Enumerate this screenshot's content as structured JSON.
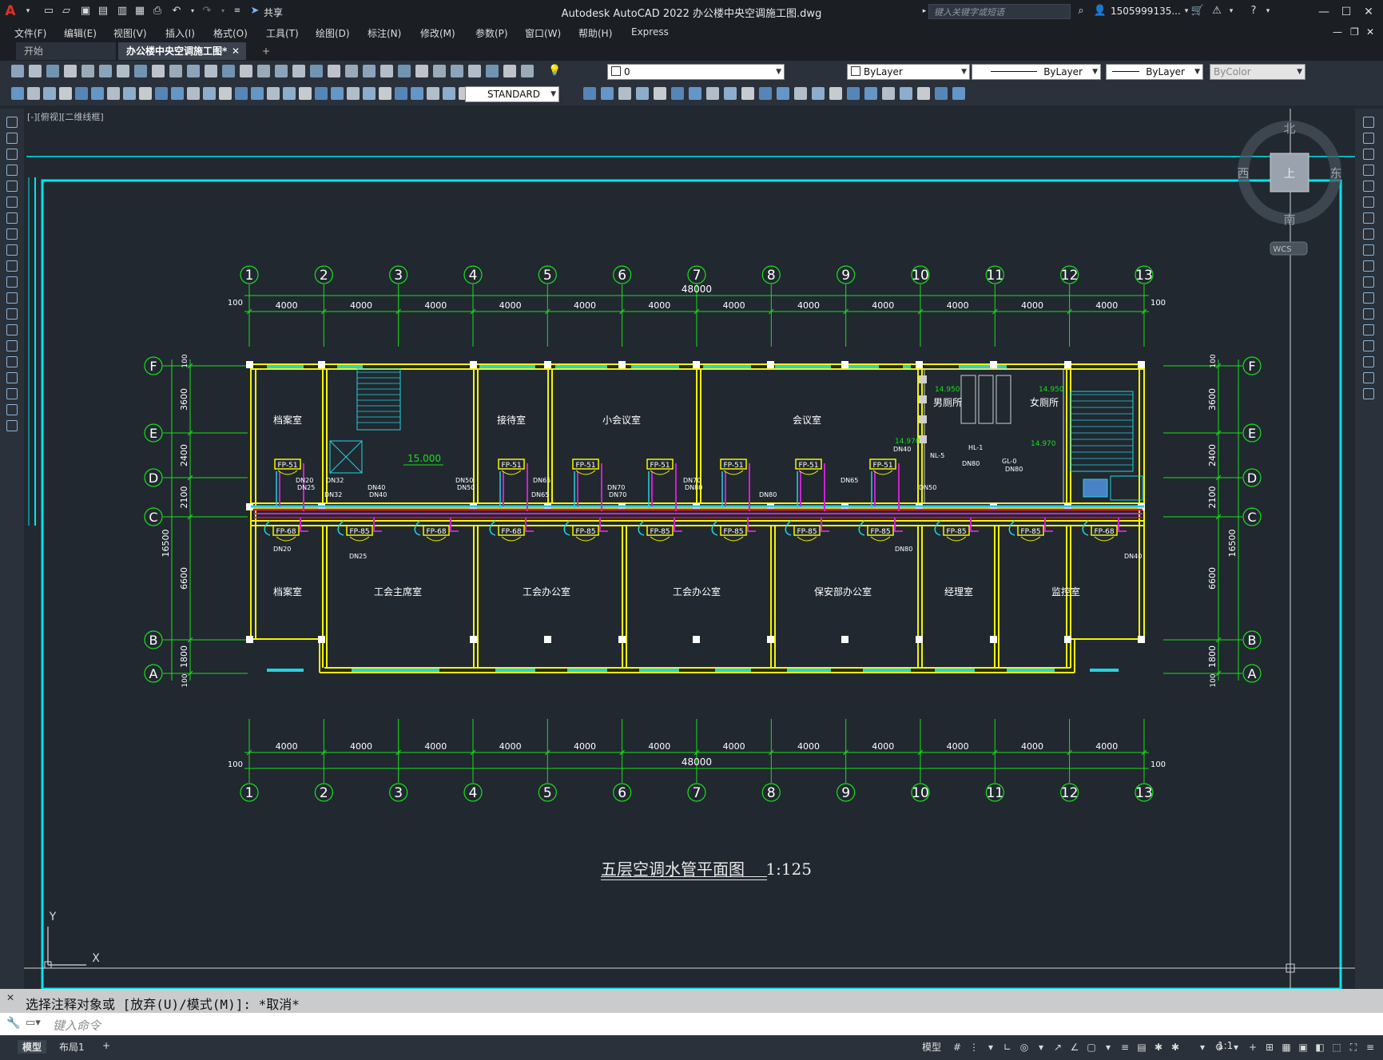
{
  "app": {
    "title": "Autodesk AutoCAD 2022     办公楼中央空调施工图.dwg",
    "share_label": "共享",
    "search_placeholder": "键入关键字或短语",
    "user": "1505999135...",
    "window_controls": [
      "minimize-icon",
      "maximize-icon",
      "close-icon"
    ]
  },
  "menu": [
    "文件(F)",
    "编辑(E)",
    "视图(V)",
    "插入(I)",
    "格式(O)",
    "工具(T)",
    "绘图(D)",
    "标注(N)",
    "修改(M)",
    "参数(P)",
    "窗口(W)",
    "帮助(H)",
    "Express"
  ],
  "tabs": {
    "start": "开始",
    "active": "办公楼中央空调施工图*",
    "close": "✕",
    "add": "+"
  },
  "properties": {
    "layer": "0",
    "color": "ByLayer",
    "linetype": "ByLayer",
    "lineweight": "ByLayer",
    "plotstyle": "ByColor",
    "textstyle": "STANDARD"
  },
  "viewport": {
    "label": "[-][俯视][二维线框]",
    "viewcube": {
      "north": "北",
      "south": "南",
      "west": "西",
      "east": "东",
      "top": "上",
      "wcs": "WCS"
    },
    "ucs": {
      "x": "X",
      "y": "Y"
    }
  },
  "drawing": {
    "title": "五层空调水管平面图",
    "scale": "1:125",
    "axes_x": [
      "1",
      "2",
      "3",
      "4",
      "5",
      "6",
      "7",
      "8",
      "9",
      "10",
      "11",
      "12",
      "13"
    ],
    "axes_y": [
      "F",
      "E",
      "D",
      "C",
      "B",
      "A"
    ],
    "bay_dim": "4000",
    "total_dim": "48000",
    "edge_dim": "100",
    "left_dims": [
      "3600",
      "2400",
      "2100",
      "6600",
      "1800"
    ],
    "total_depth": "16500",
    "elevation": "15.000",
    "elevations_small": [
      "14.950",
      "14.950",
      "14.970",
      "14.970"
    ],
    "rooms_top": [
      "档案室",
      "接待室",
      "小会议室",
      "会议室",
      "男厕所",
      "女厕所"
    ],
    "rooms_bottom": [
      "档案室",
      "工会主席室",
      "工会办公室",
      "工会办公室",
      "保安部办公室",
      "经理室",
      "监控室"
    ],
    "fcu_top": [
      "FP-51",
      "FP-51",
      "FP-51",
      "FP-51",
      "FP-51",
      "FP-51",
      "FP-51"
    ],
    "fcu_bottom": [
      "FP-68",
      "FP-85",
      "FP-68",
      "FP-68",
      "FP-85",
      "FP-85",
      "FP-85",
      "FP-85",
      "FP-85",
      "FP-85",
      "FP-85",
      "FP-68"
    ],
    "pipe_top": [
      "DN20",
      "DN25",
      "DN32",
      "DN32",
      "DN40",
      "DN40",
      "DN50",
      "DN50",
      "DN65",
      "DN65",
      "DN70",
      "DN70",
      "DN70",
      "DN80",
      "DN80",
      "DN65",
      "DN50"
    ],
    "pipe_bottom": [
      "DN20",
      "DN25",
      "DN80",
      "DN40"
    ],
    "riser_labels": [
      "DN40",
      "NL-5",
      "HL-1",
      "GL-0",
      "DN80",
      "DN80"
    ]
  },
  "command": {
    "history": "选择注释对象或 [放弃(U)/模式(M)]: *取消*",
    "placeholder": "键入命令"
  },
  "status": {
    "tabs": [
      "模型",
      "布局1",
      "+"
    ],
    "model_btn": "模型",
    "scale": "1:1"
  },
  "colors": {
    "axis_green": "#19e019",
    "wall_yellow": "#f5f500",
    "window_cyan": "#22d3e0",
    "pipe_red": "#e0103a",
    "pipe_magenta": "#d020d0",
    "frame_cyan": "#00e5ee",
    "background": "#212830"
  }
}
